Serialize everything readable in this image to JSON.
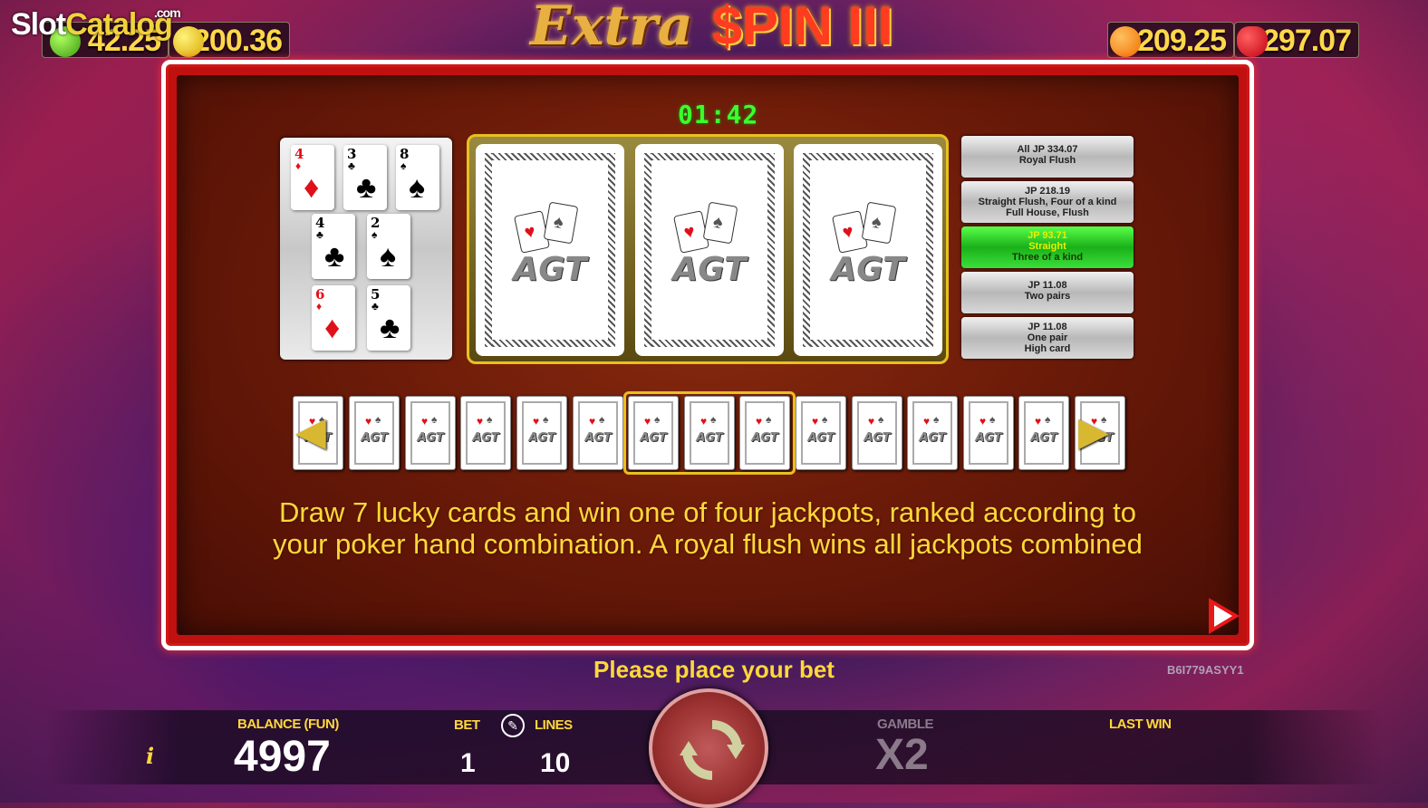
{
  "brand": {
    "logo_part1": "Slot",
    "logo_part2": "Catalog",
    "logo_suffix": ".com"
  },
  "game_title": {
    "part1": "Extra ",
    "part2": "$PIN III"
  },
  "jackpots_top": [
    {
      "fruit": "lime",
      "value": "42.25"
    },
    {
      "fruit": "lemon",
      "value": "200.36"
    },
    {
      "fruit": "orange",
      "value": "209.25"
    },
    {
      "fruit": "strawberry",
      "value": "297.07"
    }
  ],
  "timer": "01:42",
  "drawn_cards": [
    {
      "rank": "4",
      "suit": "♦",
      "color": "red"
    },
    {
      "rank": "3",
      "suit": "♣",
      "color": "black"
    },
    {
      "rank": "8",
      "suit": "♠",
      "color": "black"
    },
    {
      "rank": "4",
      "suit": "♣",
      "color": "black"
    },
    {
      "rank": "2",
      "suit": "♠",
      "color": "black"
    },
    {
      "rank": "6",
      "suit": "♦",
      "color": "red"
    },
    {
      "rank": "5",
      "suit": "♣",
      "color": "black"
    }
  ],
  "card_back_logo": "AGT",
  "jackpot_table": [
    {
      "line1": "All JP 334.07",
      "line2": "Royal Flush",
      "line3": "",
      "active": false
    },
    {
      "line1": "JP 218.19",
      "line2": "Straight Flush, Four of a kind",
      "line3": "Full House, Flush",
      "active": false
    },
    {
      "line1": "JP 93.71",
      "line2": "Straight",
      "line3": "Three of a kind",
      "active": true
    },
    {
      "line1": "JP 11.08",
      "line2": "Two pairs",
      "line3": "",
      "active": false
    },
    {
      "line1": "JP 11.08",
      "line2": "One pair",
      "line3": "High card",
      "active": false
    }
  ],
  "description": "Draw 7 lucky cards and win one of four jackpots, ranked according to your poker hand combination. A royal flush wins all jackpots combined",
  "status_message": "Please place your bet",
  "game_id": "B6I779ASYY1",
  "bottom": {
    "info_label": "i",
    "balance_label": "BALANCE (FUN)",
    "balance_value": "4997",
    "bet_label": "BET",
    "bet_value": "1",
    "lines_label": "LINES",
    "lines_value": "10",
    "gamble_label": "GAMBLE",
    "gamble_value": "X2",
    "last_win_label": "LAST WIN"
  },
  "colors": {
    "accent_yellow": "#ffd83a",
    "frame_red": "#d01818",
    "active_green": "#3ae03a"
  }
}
